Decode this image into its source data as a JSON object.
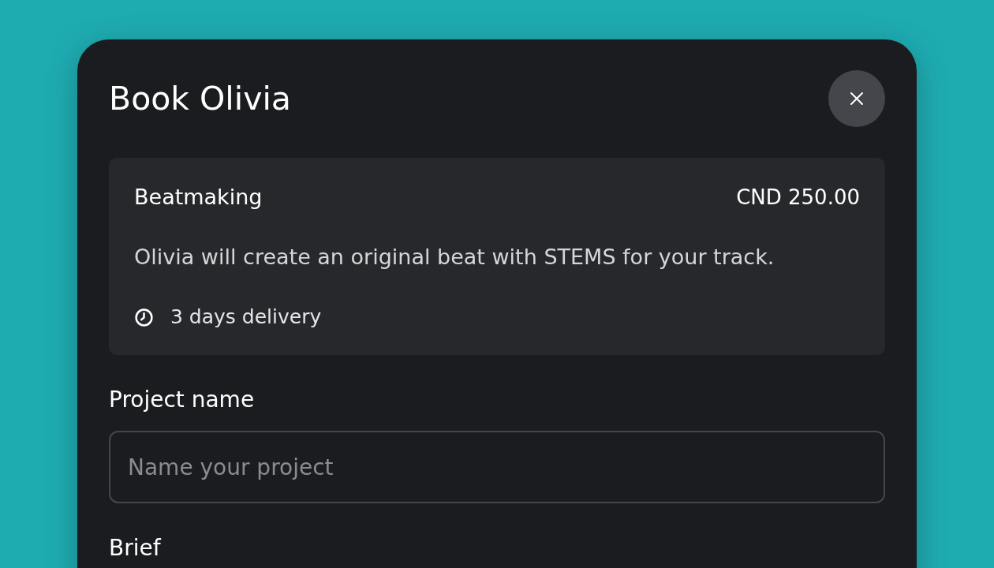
{
  "dialog": {
    "title": "Book Olivia"
  },
  "service": {
    "name": "Beatmaking",
    "price": "CND 250.00",
    "description": "Olivia will create an original beat with STEMS for your track.",
    "delivery": "3 days delivery"
  },
  "fields": [
    {
      "label": "Project name",
      "placeholder": "Name your project"
    },
    {
      "label": "Brief"
    }
  ]
}
